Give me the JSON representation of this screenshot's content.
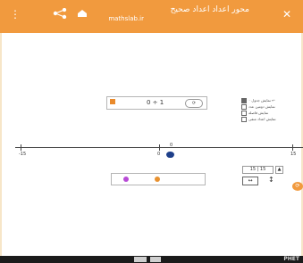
{
  "colors": {
    "topbar": "#f19a3e",
    "marker": "#1e3f8a",
    "ball_purple": "#b84ad6",
    "ball_orange": "#e8912f"
  },
  "header": {
    "menu_icon": "dots-vertical-icon",
    "share_icon": "share-icon",
    "home_icon": "home-icon",
    "title": "محور اعداد اعداد صحیح",
    "url": "mathslab.ir",
    "close_icon": "close-icon"
  },
  "control_panel": {
    "expression": "0 ÷ 1",
    "toggle_label": "⟳"
  },
  "legend": {
    "items": [
      {
        "label": "نمایش جدول ۰ ↩",
        "checked": true
      },
      {
        "label": "نمایش دومین عدد",
        "checked": false
      },
      {
        "label": "نمایش فاصله",
        "checked": false
      },
      {
        "label": "نمایش اعداد منفی",
        "checked": false
      }
    ]
  },
  "axis": {
    "min_label": "-15",
    "zero_label": "0",
    "max_label": "15",
    "marker_label": "0"
  },
  "range": {
    "value": "15 | 15",
    "step_up": "▲",
    "arrows": "↔",
    "updown": "↕"
  },
  "bottombar": {
    "logo": "PHET"
  }
}
